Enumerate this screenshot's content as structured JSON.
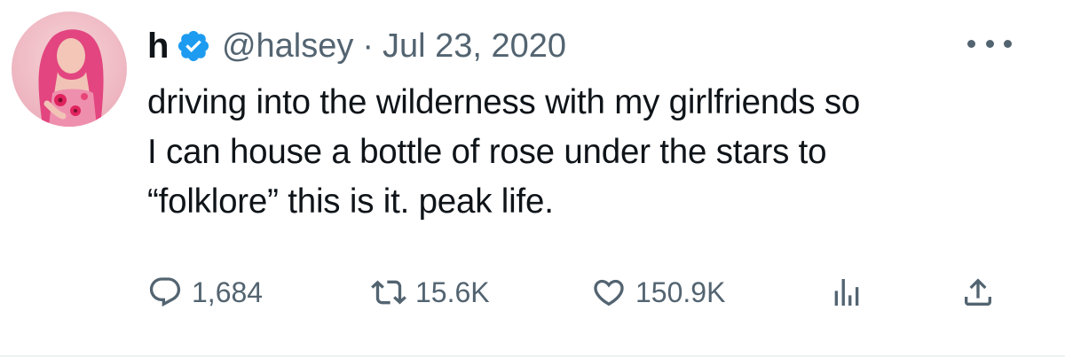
{
  "tweet": {
    "display_name": "h",
    "handle": "@halsey",
    "separator": "·",
    "date": "Jul 23, 2020",
    "text_lines": [
      "driving into the wilderness with my girlfriends so",
      "I can house a bottle of rose under the stars to",
      "“folklore” this is it. peak life."
    ]
  },
  "metrics": {
    "replies": "1,684",
    "retweets": "15.6K",
    "likes": "150.9K"
  },
  "icons": {
    "verified": "verified-badge-icon",
    "more": "more-options-icon",
    "reply": "reply-icon",
    "retweet": "retweet-icon",
    "like": "heart-icon",
    "views": "views-chart-icon",
    "share": "share-icon"
  },
  "colors": {
    "text": "#0f1419",
    "secondary": "#536471",
    "verified": "#1d9bf0"
  }
}
